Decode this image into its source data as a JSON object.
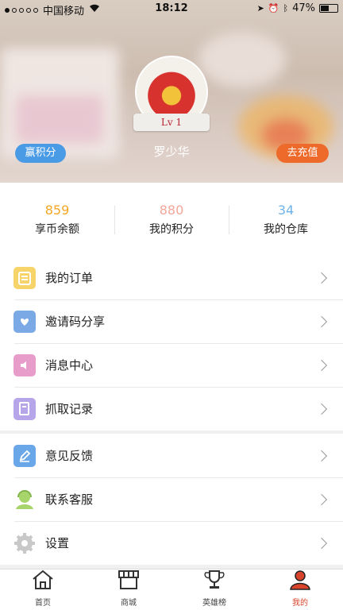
{
  "status_bar": {
    "carrier": "中国移动",
    "time": "18:12",
    "battery": "47%"
  },
  "profile": {
    "username": "罗少华",
    "level": "Lv 1",
    "earn_points_label": "赢积分",
    "recharge_label": "去充值"
  },
  "stats": [
    {
      "value": "859",
      "label": "享币余额",
      "color": "#f5a623"
    },
    {
      "value": "880",
      "label": "我的积分",
      "color": "#f3a79b"
    },
    {
      "value": "34",
      "label": "我的仓库",
      "color": "#6fb3e8"
    }
  ],
  "menu_group_1": [
    {
      "label": "我的订单",
      "icon": "order-icon",
      "color": "#f7d46a"
    },
    {
      "label": "邀请码分享",
      "icon": "share-icon",
      "color": "#7aa9e6"
    },
    {
      "label": "消息中心",
      "icon": "message-icon",
      "color": "#e79cc9"
    },
    {
      "label": "抓取记录",
      "icon": "record-icon",
      "color": "#b7a5ea"
    }
  ],
  "menu_group_2": [
    {
      "label": "意见反馈",
      "icon": "feedback-icon",
      "color": "#6aa7e8"
    },
    {
      "label": "联系客服",
      "icon": "customer-service-icon",
      "color": "#a7d46b"
    },
    {
      "label": "设置",
      "icon": "settings-icon",
      "color": "#c8c8c8"
    }
  ],
  "tabs": [
    {
      "label": "首页",
      "icon": "home-icon"
    },
    {
      "label": "商城",
      "icon": "store-icon"
    },
    {
      "label": "英雄榜",
      "icon": "trophy-icon"
    },
    {
      "label": "我的",
      "icon": "profile-icon",
      "active": true
    }
  ]
}
